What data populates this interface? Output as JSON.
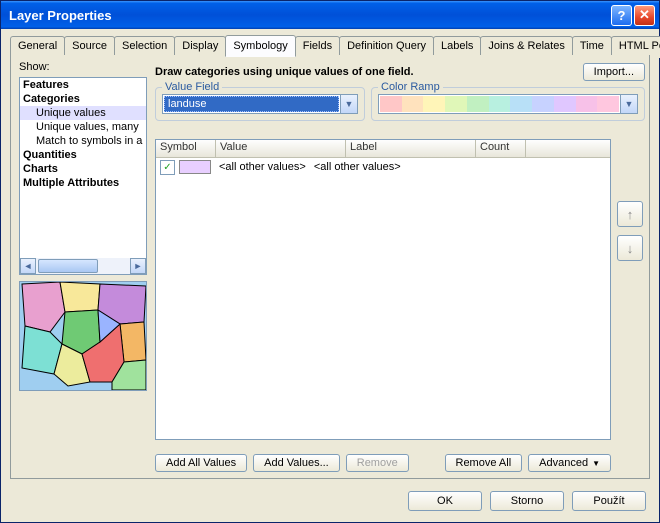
{
  "title": "Layer Properties",
  "tabs": {
    "general": "General",
    "source": "Source",
    "selection": "Selection",
    "display": "Display",
    "symbology": "Symbology",
    "fields": "Fields",
    "defquery": "Definition Query",
    "labels": "Labels",
    "joins": "Joins & Relates",
    "time": "Time",
    "htmlpopup": "HTML Popup"
  },
  "show_label": "Show:",
  "tree": {
    "features": "Features",
    "categories": "Categories",
    "cat_unique": "Unique values",
    "cat_unique_many": "Unique values, many",
    "cat_match": "Match to symbols in a",
    "quantities": "Quantities",
    "charts": "Charts",
    "multiattr": "Multiple Attributes"
  },
  "header_text": "Draw categories using unique values of one field.",
  "import_btn": "Import...",
  "value_field": {
    "legend": "Value Field",
    "value": "landuse"
  },
  "color_ramp_legend": "Color Ramp",
  "color_ramp": [
    "#ffc7c7",
    "#ffe2bd",
    "#fff5b8",
    "#e0f7b8",
    "#c1f0c1",
    "#b8f0e0",
    "#b8e0f7",
    "#c7d2ff",
    "#e0c7ff",
    "#f7c1e8",
    "#ffc7df"
  ],
  "cols": {
    "symbol": "Symbol",
    "value": "Value",
    "label": "Label",
    "count": "Count"
  },
  "rows": [
    {
      "checked": true,
      "swatch": "#e8cfff",
      "value": "<all other values>",
      "label": "<all other values>",
      "count": ""
    }
  ],
  "btns": {
    "add_all": "Add All Values",
    "add": "Add Values...",
    "remove": "Remove",
    "remove_all": "Remove All",
    "advanced": "Advanced"
  },
  "dlg": {
    "ok": "OK",
    "cancel": "Storno",
    "apply": "Použít"
  }
}
